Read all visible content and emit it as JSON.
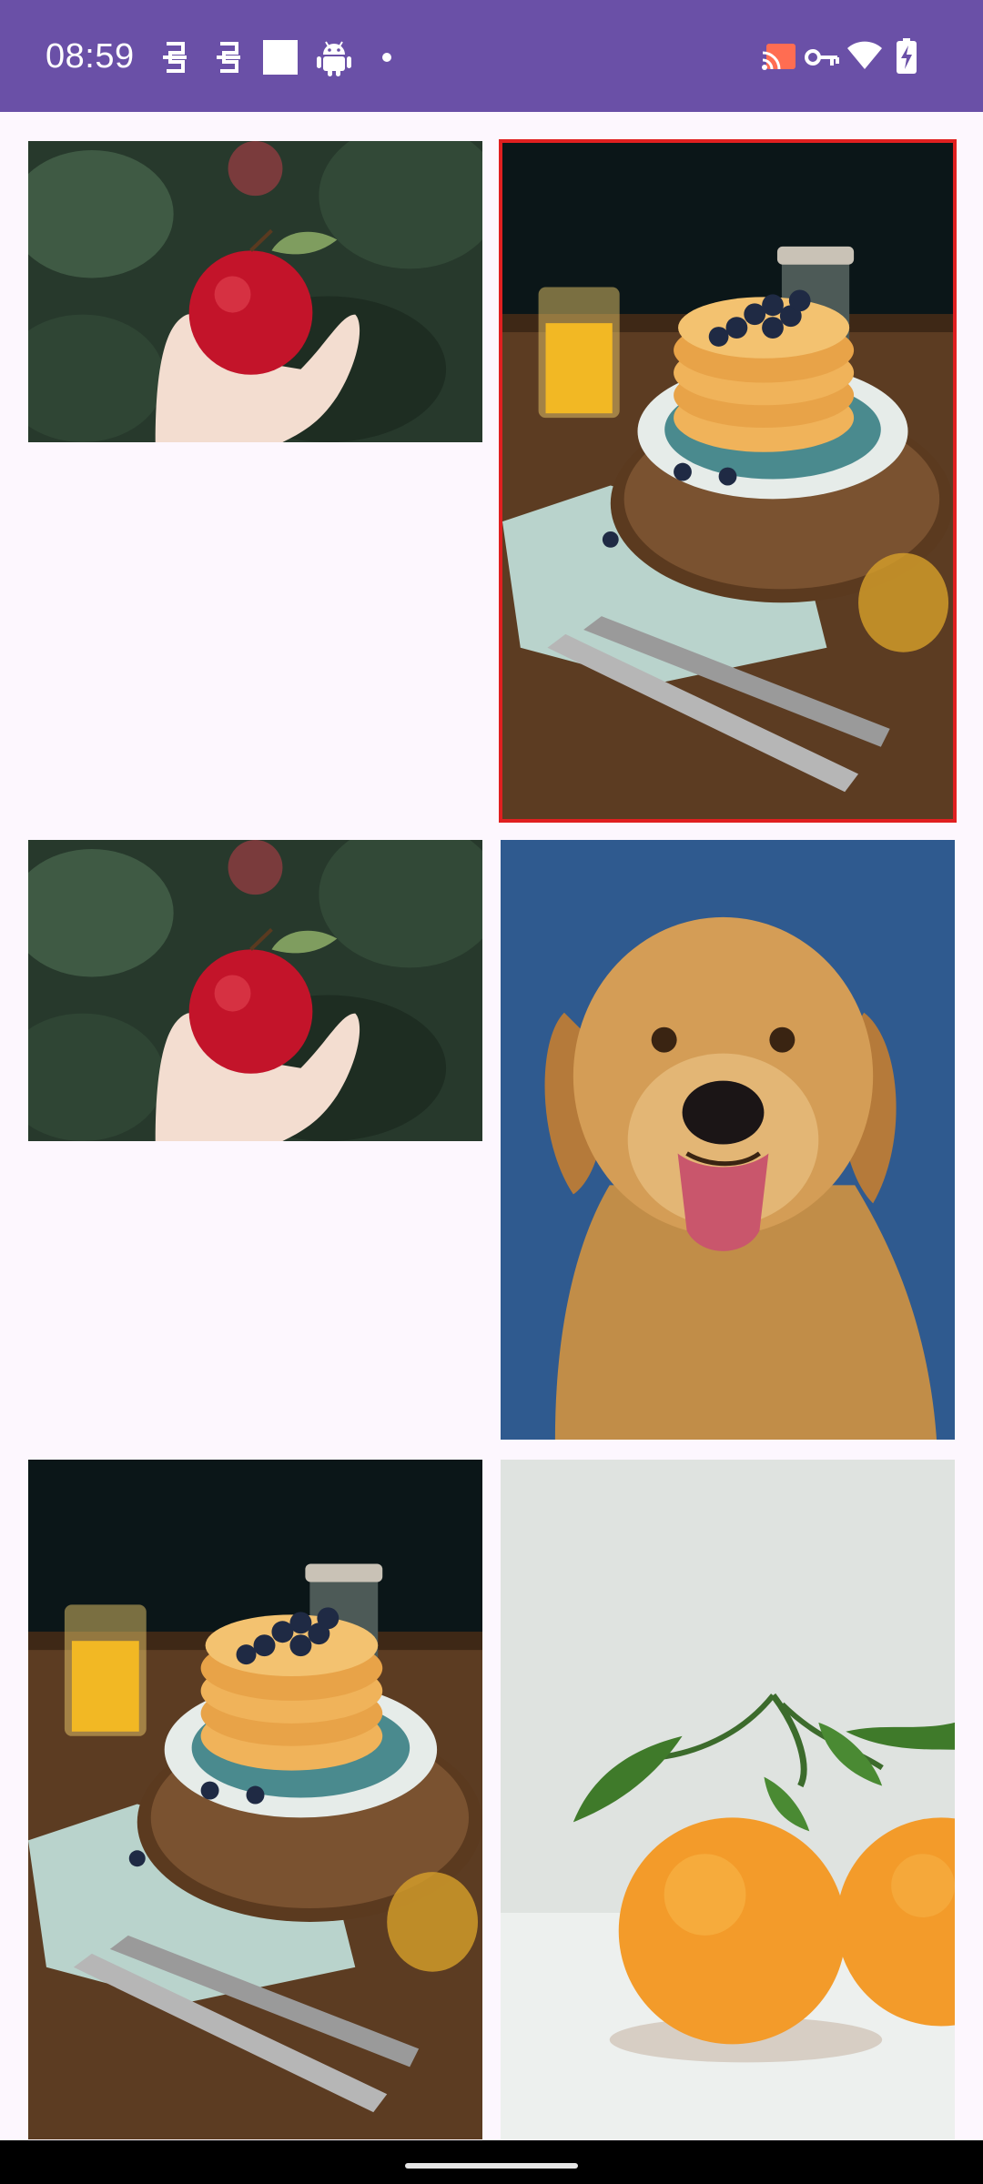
{
  "status_bar": {
    "time": "08:59",
    "background": "#6a50a7",
    "left_icons": [
      "notification-app-icon",
      "notification-app-icon",
      "white-square-icon",
      "android-debug-icon",
      "more-dot-icon"
    ],
    "right_icons": [
      "cast-icon",
      "vpn-key-icon",
      "wifi-icon",
      "battery-charging-icon"
    ]
  },
  "gallery": {
    "columns": 2,
    "selected_color": "#e02020",
    "items": [
      {
        "subject": "apple",
        "column": "left",
        "row": 1,
        "selected": false
      },
      {
        "subject": "pancakes",
        "column": "right",
        "row": 1,
        "selected": true
      },
      {
        "subject": "apple",
        "column": "left",
        "row": 2,
        "selected": false
      },
      {
        "subject": "dog",
        "column": "right",
        "row": 2,
        "selected": false
      },
      {
        "subject": "pancakes",
        "column": "left",
        "row": 3,
        "selected": false
      },
      {
        "subject": "oranges",
        "column": "right",
        "row": 3,
        "selected": false
      }
    ]
  }
}
